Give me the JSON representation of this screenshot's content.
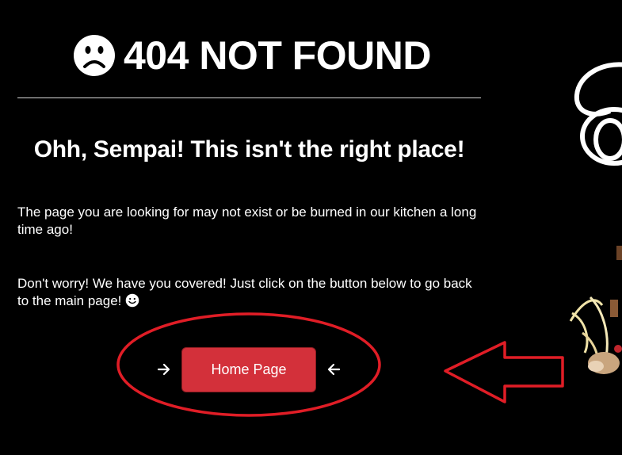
{
  "header": {
    "title": "404 NOT FOUND",
    "icon": "sad-face-icon"
  },
  "main": {
    "subtitle": "Ohh, Sempai! This isn't the right place!",
    "paragraph_1": "The page you are looking for may not exist or be burned in our kitchen a long time ago!",
    "paragraph_2": "Don't worry! We have you covered! Just click on the button below to go back to the main page!",
    "paragraph_2_icon": "smiling-face-icon"
  },
  "home_button": {
    "label": "Home Page",
    "color": "#d3303a",
    "left_icon": "arrow-right-icon",
    "right_icon": "arrow-left-icon"
  },
  "annotations": {
    "color": "#e01d26",
    "items": [
      "red-ellipse-highlight",
      "red-pointing-arrow"
    ]
  },
  "theme": {
    "background": "#000000",
    "text": "#ffffff"
  }
}
